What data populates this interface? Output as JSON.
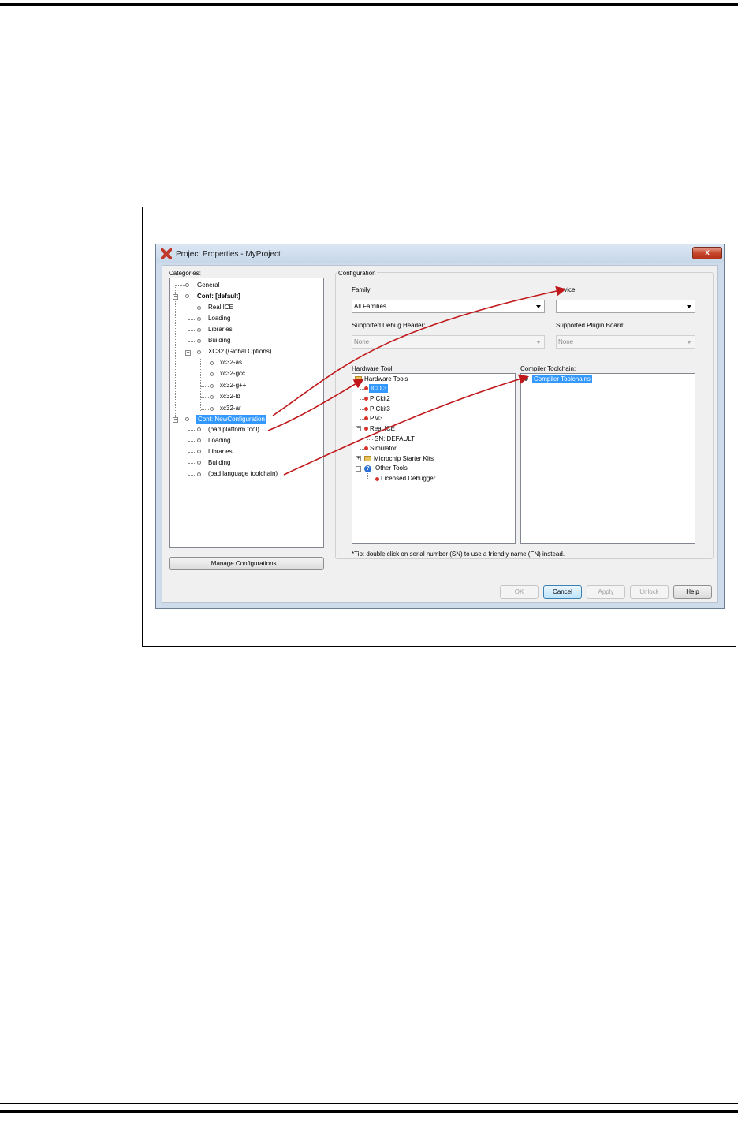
{
  "dialog": {
    "title": "Project Properties - MyProject",
    "close_label": "x",
    "categories_label": "Categories:",
    "categories": [
      {
        "label": "General"
      },
      {
        "label": "Conf: [default]"
      },
      {
        "label": "Real ICE"
      },
      {
        "label": "Loading"
      },
      {
        "label": "Libraries"
      },
      {
        "label": "Building"
      },
      {
        "label": "XC32 (Global Options)"
      },
      {
        "label": "xc32-as"
      },
      {
        "label": "xc32-gcc"
      },
      {
        "label": "xc32-g++"
      },
      {
        "label": "xc32-ld"
      },
      {
        "label": "xc32-ar"
      },
      {
        "label": "Conf: NewConfiguration"
      },
      {
        "label": "(bad platform tool)"
      },
      {
        "label": "Loading"
      },
      {
        "label": "Libraries"
      },
      {
        "label": "Building"
      },
      {
        "label": "(bad language toolchain)"
      }
    ],
    "manage_configurations": "Manage Configurations...",
    "configuration": {
      "group_label": "Configuration",
      "family_label": "Family:",
      "family_value": "All Families",
      "device_label": "Device:",
      "device_value": "",
      "debug_header_label": "Supported Debug Header:",
      "debug_header_value": "None",
      "plugin_board_label": "Supported Plugin Board:",
      "plugin_board_value": "None",
      "hardware_tool_label": "Hardware Tool:",
      "hardware_tools": [
        {
          "label": "Hardware Tools"
        },
        {
          "label": "ICD 3"
        },
        {
          "label": "PICkit2"
        },
        {
          "label": "PICkit3"
        },
        {
          "label": "PM3"
        },
        {
          "label": "Real ICE"
        },
        {
          "label": "SN: DEFAULT"
        },
        {
          "label": "Simulator"
        },
        {
          "label": "Microchip Starter Kits"
        },
        {
          "label": "Other Tools"
        },
        {
          "label": "Licensed Debugger"
        }
      ],
      "compiler_toolchain_label": "Compiler Toolchain:",
      "compiler_toolchains": [
        {
          "label": "Compiler Toolchains"
        }
      ],
      "tip": "*Tip: double click on serial number (SN) to use a friendly name (FN) instead."
    },
    "buttons": {
      "ok": "OK",
      "cancel": "Cancel",
      "apply": "Apply",
      "unlock": "Unlock",
      "help": "Help"
    }
  },
  "colors": {
    "selection": "#3399ff",
    "annotation_arrow": "#c0181a",
    "window_frame": "#cddbea"
  },
  "icons": [
    "app-icon",
    "close-icon",
    "folder-icon",
    "question-icon",
    "tool-dot-icon",
    "chevron-down-icon"
  ]
}
